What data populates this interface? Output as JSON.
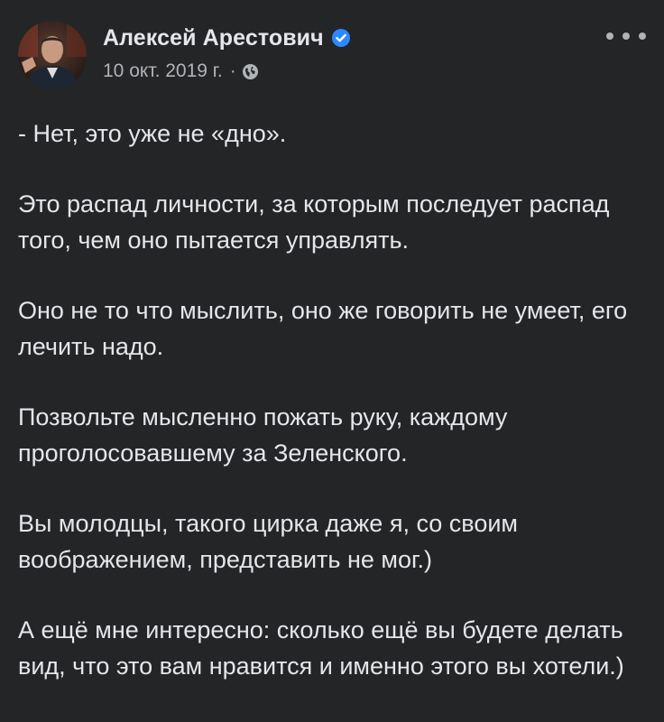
{
  "post": {
    "author": "Алексей Арестович",
    "date": "10 окт. 2019 г.",
    "separator": "·",
    "privacy_icon": "globe-icon",
    "verified_icon": "verified-badge-icon",
    "more_icon": "more-options-icon",
    "paragraphs": [
      "- Нет, это уже не «дно».",
      "Это распад личности, за которым последует распад того, чем оно пытается управлять.",
      "Оно не то что мыслить, оно же говорить не умеет, его лечить надо.",
      "Позвольте мысленно пожать руку, каждому проголосовавшему за Зеленского.",
      "Вы молодцы, такого цирка даже я, со своим воображением, представить не мог.)",
      "А ещё мне интересно: сколько ещё вы будете делать вид, что это вам нравится и именно этого вы хотели.)"
    ]
  },
  "colors": {
    "background": "#242526",
    "text": "#e4e6eb",
    "secondary": "#b0b3b8",
    "verified": "#2d88ff"
  }
}
